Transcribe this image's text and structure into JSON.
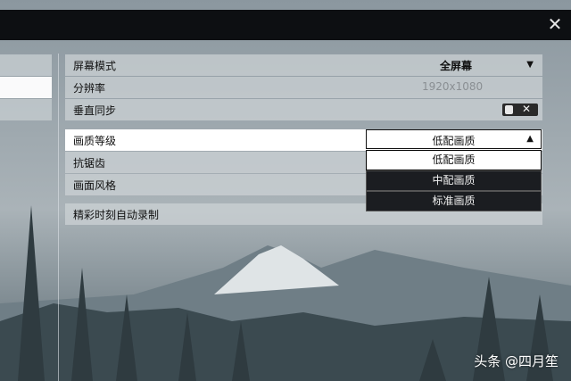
{
  "window": {
    "close_icon": "close-icon"
  },
  "settings": {
    "screen_mode": {
      "label": "屏幕模式",
      "value": "全屏幕"
    },
    "resolution": {
      "label": "分辨率",
      "value": "1920x1080"
    },
    "vsync": {
      "label": "垂直同步",
      "toggle_state": "off"
    },
    "quality": {
      "label": "画质等级",
      "value": "低配画质"
    },
    "antialias": {
      "label": "抗锯齿"
    },
    "style": {
      "label": "画面风格"
    },
    "highlight_record": {
      "label": "精彩时刻自动录制"
    }
  },
  "dropdown": {
    "options": [
      "低配画质",
      "中配画质",
      "标准画质"
    ],
    "selected_index": 0
  },
  "watermark": "头条 @四月笙"
}
